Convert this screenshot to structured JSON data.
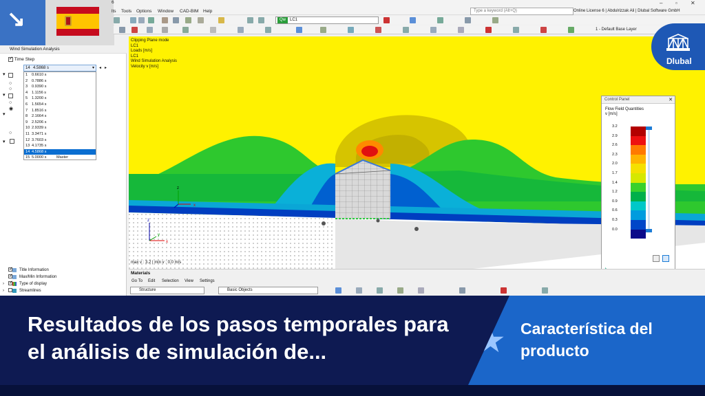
{
  "menubar": {
    "items": [
      "Tools",
      "Options",
      "Window",
      "CAD-BIM",
      "Help"
    ],
    "search_placeholder": "Type a keyword (Alt+Q)",
    "license": "Online License 6 | Abdulrizzak Ali | Dlubal Software GmbH",
    "fragment_left": "6",
    "fragment_mid": "lts"
  },
  "toolbar": {
    "lc_badge": "Qw",
    "lc_value": "LC1",
    "layer_label": "1 - Default Base Layer"
  },
  "left_panel": {
    "title": "Wind Simulation Analysis",
    "time_step_label": "Time Step",
    "time_step_current_num": "14",
    "time_step_current_val": "4.5868 s",
    "time_steps": [
      {
        "n": "1",
        "v": "0.6610 s",
        "note": ""
      },
      {
        "n": "2",
        "v": "0.7886 s",
        "note": ""
      },
      {
        "n": "3",
        "v": "0.9390 s",
        "note": ""
      },
      {
        "n": "4",
        "v": "1.1156 s",
        "note": ""
      },
      {
        "n": "5",
        "v": "1.3200 s",
        "note": ""
      },
      {
        "n": "6",
        "v": "1.5654 s",
        "note": ""
      },
      {
        "n": "7",
        "v": "1.8516 s",
        "note": ""
      },
      {
        "n": "8",
        "v": "2.1664 s",
        "note": ""
      },
      {
        "n": "9",
        "v": "2.5206 s",
        "note": ""
      },
      {
        "n": "10",
        "v": "2.9339 s",
        "note": ""
      },
      {
        "n": "11",
        "v": "3.3471 s",
        "note": ""
      },
      {
        "n": "12",
        "v": "3.7603 s",
        "note": ""
      },
      {
        "n": "13",
        "v": "4.1735 s",
        "note": ""
      },
      {
        "n": "14",
        "v": "4.5868 s",
        "note": ""
      },
      {
        "n": "15",
        "v": "5.0000 s",
        "note": "Master"
      }
    ],
    "selected_index": 13,
    "bottom_items": [
      "Title Information",
      "Max/Min Information",
      "Type of display",
      "Streamlines"
    ]
  },
  "viewport": {
    "info_lines": [
      "Clipping Plane mode",
      "LC1",
      "Loads [m/s]",
      "LC1",
      "Wind Simulation Analysis",
      "Velocity v [m/s]"
    ],
    "status": "max v : 3.2 | min v : 0.0 m/s",
    "axis_x": "x",
    "axis_y": "y",
    "axis_z": "z"
  },
  "control_panel": {
    "title": "Control Panel",
    "heading": "Flow Field Quantities",
    "unit": "v [m/s]",
    "legend": [
      {
        "value": "3.2",
        "color": "#b30000"
      },
      {
        "value": "2.9",
        "color": "#ee1010"
      },
      {
        "value": "2.6",
        "color": "#ff7a00"
      },
      {
        "value": "2.3",
        "color": "#ffb400"
      },
      {
        "value": "2.0",
        "color": "#f5e000"
      },
      {
        "value": "1.7",
        "color": "#d6e800"
      },
      {
        "value": "1.4",
        "color": "#39d12c"
      },
      {
        "value": "1.2",
        "color": "#00b04a"
      },
      {
        "value": "0.9",
        "color": "#00c8c8"
      },
      {
        "value": "0.6",
        "color": "#009cde"
      },
      {
        "value": "0.3",
        "color": "#0046c8"
      },
      {
        "value": "0.0",
        "color": "#0a0a8a"
      }
    ]
  },
  "materials": {
    "title": "Materials",
    "menu": [
      "Go To",
      "Edit",
      "Selection",
      "View",
      "Settings"
    ],
    "combo1": "Structure",
    "combo2": "Basic Objects"
  },
  "banner": {
    "title": "Resultados de los pasos temporales para el análisis de simulación de...",
    "feature_label": "Característica del producto"
  },
  "logo": {
    "text": "Dlubal"
  },
  "colors": {
    "banner_bg": "#0e1a52",
    "banner_accent": "#1b66c9",
    "corner_blue": "#3a72c4",
    "viewport_field": "#fff200"
  }
}
